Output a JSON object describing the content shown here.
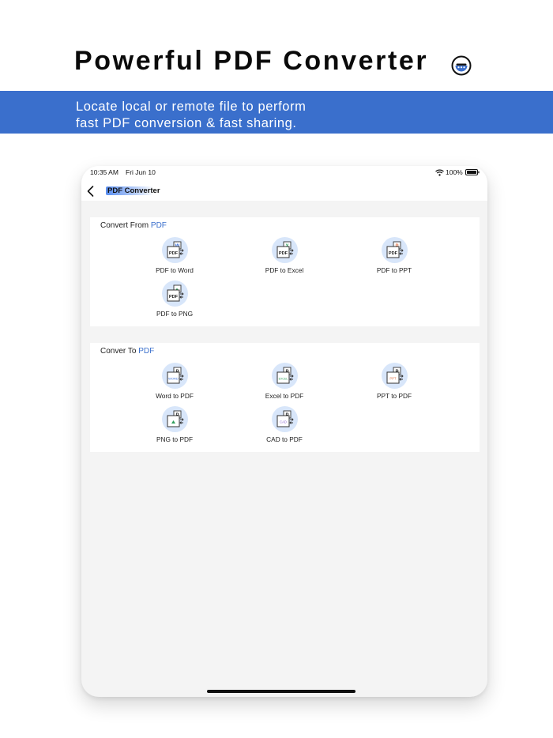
{
  "promo": {
    "title": "Powerful PDF Converter",
    "subtitle_line1": "Locate local or remote file to perform",
    "subtitle_line2": "fast PDF conversion & fast sharing."
  },
  "status_bar": {
    "time": "10:35 AM",
    "date": "Fri Jun 10",
    "battery": "100%"
  },
  "nav": {
    "title": "PDF Converter"
  },
  "convert_from": {
    "heading_prefix": "Convert From ",
    "heading_accent": "PDF",
    "items": [
      {
        "label": "PDF to Word",
        "icon": "pdf-to-word-icon",
        "badge": "W"
      },
      {
        "label": "PDF to Excel",
        "icon": "pdf-to-excel-icon",
        "badge": "X"
      },
      {
        "label": "PDF to PPT",
        "icon": "pdf-to-ppt-icon",
        "badge": "P"
      },
      {
        "label": "PDF to PNG",
        "icon": "pdf-to-png-icon",
        "badge": "▲"
      }
    ]
  },
  "convert_to": {
    "heading_prefix": "Conver To ",
    "heading_accent": "PDF",
    "items": [
      {
        "label": "Word to PDF",
        "icon": "word-to-pdf-icon",
        "tag": "WORD"
      },
      {
        "label": "Excel to PDF",
        "icon": "excel-to-pdf-icon",
        "tag": "EXCEL"
      },
      {
        "label": "PPT to PDF",
        "icon": "ppt-to-pdf-icon",
        "tag": "PPT"
      },
      {
        "label": "PNG to PDF",
        "icon": "png-to-pdf-icon",
        "tag": "▲"
      },
      {
        "label": "CAD to PDF",
        "icon": "cad-to-pdf-icon",
        "tag": "CAD"
      }
    ]
  },
  "colors": {
    "accent": "#3a6fcc",
    "icon_bg": "#d8e6fa",
    "word": "#3b6fd8",
    "excel": "#2e9e5b",
    "ppt": "#e0744a",
    "png": "#2e9e5b",
    "cad": "#8a63d2"
  }
}
